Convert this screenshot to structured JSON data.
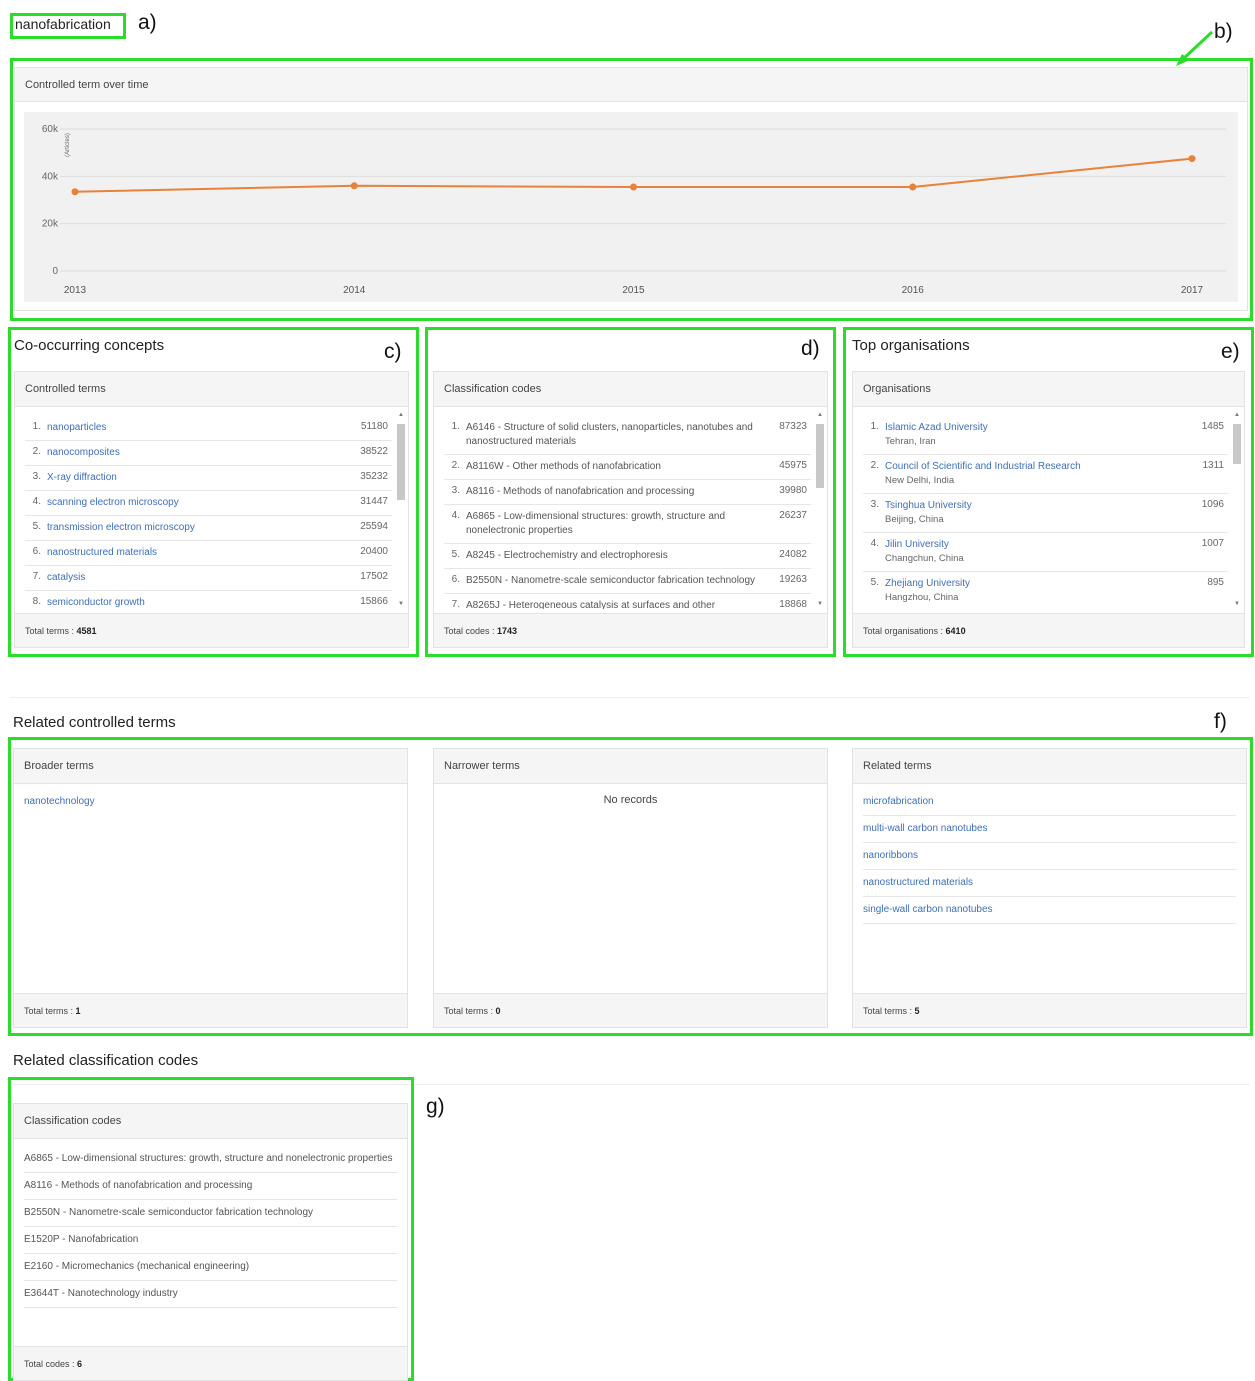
{
  "search": {
    "term": "nanofabrication"
  },
  "labels": {
    "a": "a)",
    "b": "b)",
    "c": "c)",
    "d": "d)",
    "e": "e)",
    "f": "f)",
    "g": "g)"
  },
  "timeline": {
    "panel_title": "Controlled term over time",
    "y_axis_label": "(Articles)"
  },
  "chart_data": {
    "type": "line",
    "title": "Controlled term over time",
    "ylabel": "(Articles)",
    "x": [
      "2013",
      "2014",
      "2015",
      "2016",
      "2017"
    ],
    "y_ticks": [
      "0",
      "20k",
      "40k",
      "60k"
    ],
    "ylim": [
      0,
      60000
    ],
    "series": [
      {
        "values": [
          33500,
          36000,
          35500,
          35500,
          47500
        ]
      }
    ],
    "line_color": "#e8823a",
    "grid": true
  },
  "concepts": {
    "section_title": "Co-occurring concepts",
    "panel_title": "Controlled terms",
    "items": [
      {
        "n": "1.",
        "label": "nanoparticles",
        "count": "51180"
      },
      {
        "n": "2.",
        "label": "nanocomposites",
        "count": "38522"
      },
      {
        "n": "3.",
        "label": "X-ray diffraction",
        "count": "35232"
      },
      {
        "n": "4.",
        "label": "scanning electron microscopy",
        "count": "31447"
      },
      {
        "n": "5.",
        "label": "transmission electron microscopy",
        "count": "25594"
      },
      {
        "n": "6.",
        "label": "nanostructured materials",
        "count": "20400"
      },
      {
        "n": "7.",
        "label": "catalysis",
        "count": "17502"
      },
      {
        "n": "8.",
        "label": "semiconductor growth",
        "count": "15866"
      }
    ],
    "footer_label": "Total terms : ",
    "footer_value": "4581"
  },
  "codes": {
    "panel_title": "Classification codes",
    "items": [
      {
        "n": "1.",
        "label": "A6146 - Structure of solid clusters, nanoparticles, nanotubes and nanostructured materials",
        "count": "87323"
      },
      {
        "n": "2.",
        "label": "A8116W - Other methods of nanofabrication",
        "count": "45975"
      },
      {
        "n": "3.",
        "label": "A8116 - Methods of nanofabrication and processing",
        "count": "39980"
      },
      {
        "n": "4.",
        "label": "A6865 - Low-dimensional structures: growth, structure and nonelectronic properties",
        "count": "26237"
      },
      {
        "n": "5.",
        "label": "A8245 - Electrochemistry and electrophoresis",
        "count": "24082"
      },
      {
        "n": "6.",
        "label": "B2550N - Nanometre-scale semiconductor fabrication technology",
        "count": "19263"
      },
      {
        "n": "7.",
        "label": "A8265J - Heterogeneous catalysis at surfaces and other",
        "count": "18868"
      }
    ],
    "footer_label": "Total codes : ",
    "footer_value": "1743"
  },
  "orgs": {
    "section_title": "Top organisations",
    "panel_title": "Organisations",
    "items": [
      {
        "n": "1.",
        "label": "Islamic Azad University",
        "place": "Tehran, Iran",
        "count": "1485"
      },
      {
        "n": "2.",
        "label": "Council of Scientific and Industrial Research",
        "place": "New Delhi, India",
        "count": "1311"
      },
      {
        "n": "3.",
        "label": "Tsinghua University",
        "place": "Beijing, China",
        "count": "1096"
      },
      {
        "n": "4.",
        "label": "Jilin University",
        "place": "Changchun, China",
        "count": "1007"
      },
      {
        "n": "5.",
        "label": "Zhejiang University",
        "place": "Hangzhou, China",
        "count": "895"
      }
    ],
    "footer_label": "Total organisations : ",
    "footer_value": "6410"
  },
  "related": {
    "section_title": "Related controlled terms",
    "broader": {
      "title": "Broader terms",
      "items": [
        "nanotechnology"
      ],
      "footer_label": "Total terms : ",
      "footer_value": "1"
    },
    "narrower": {
      "title": "Narrower terms",
      "empty_text": "No records",
      "footer_label": "Total terms : ",
      "footer_value": "0"
    },
    "related_terms": {
      "title": "Related terms",
      "items": [
        "microfabrication",
        "multi-wall carbon nanotubes",
        "nanoribbons",
        "nanostructured materials",
        "single-wall carbon nanotubes"
      ],
      "footer_label": "Total terms : ",
      "footer_value": "5"
    }
  },
  "related_codes": {
    "section_title": "Related classification codes",
    "panel_title": "Classification codes",
    "items": [
      "A6865 - Low-dimensional structures: growth, structure and nonelectronic properties",
      "A8116 - Methods of nanofabrication and processing",
      "B2550N - Nanometre-scale semiconductor fabrication technology",
      "E1520P - Nanofabrication",
      "E2160 - Micromechanics (mechanical engineering)",
      "E3644T - Nanotechnology industry"
    ],
    "footer_label": "Total codes : ",
    "footer_value": "6"
  },
  "colors": {
    "highlight": "#2bdc2b",
    "link": "#3f6fb5",
    "series": "#e8823a"
  }
}
